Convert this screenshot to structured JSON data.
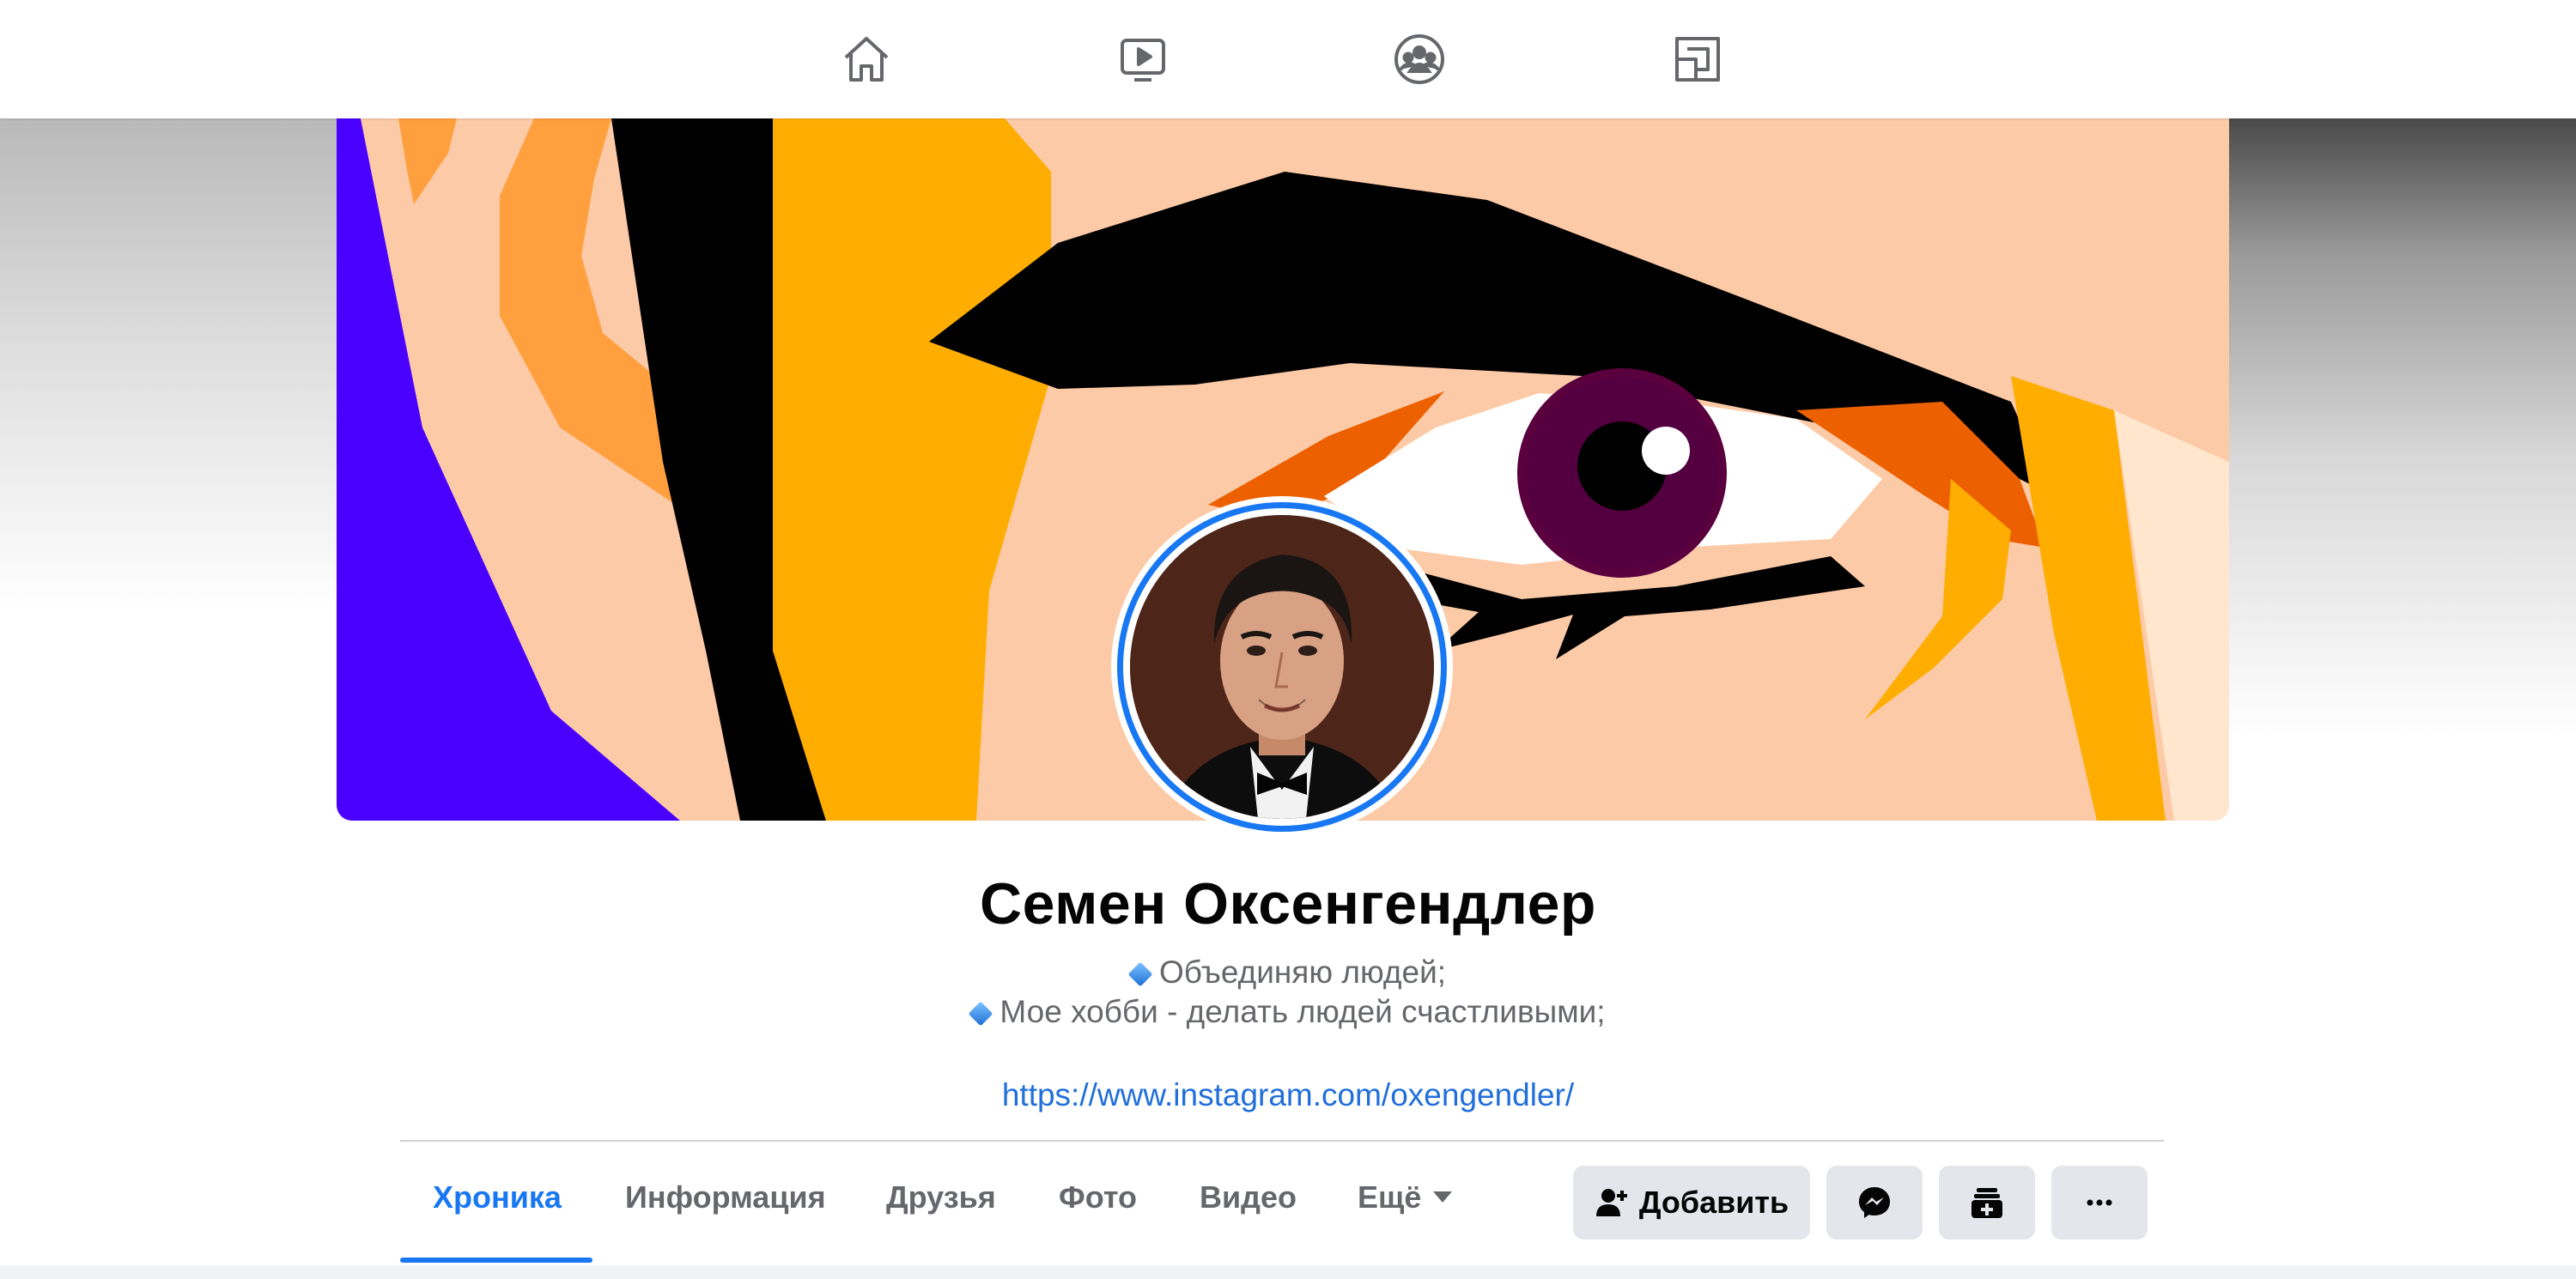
{
  "nav": {
    "icons": [
      "home-icon",
      "watch-video-icon",
      "groups-icon",
      "gaming-icon"
    ]
  },
  "profile": {
    "name": "Семен Оксенгендлер",
    "bio_line_1": "Объединяю людей;",
    "bio_line_2": "Мое хобби - делать людей счастливыми;",
    "link": "https://www.instagram.com/oxengendler/"
  },
  "tabs": [
    {
      "label": "Хроника",
      "active": true
    },
    {
      "label": "Информация",
      "active": false
    },
    {
      "label": "Друзья",
      "active": false
    },
    {
      "label": "Фото",
      "active": false
    },
    {
      "label": "Видео",
      "active": false
    },
    {
      "label": "Ещё",
      "active": false
    }
  ],
  "actions": {
    "add_friend_label": "Добавить",
    "messenger_icon": "messenger-icon",
    "follow_icon": "stack-icon",
    "more_icon": "more-icon"
  },
  "colors": {
    "accent": "#1877f2",
    "link": "#216fdb",
    "button_bg": "#e4e6eb"
  }
}
